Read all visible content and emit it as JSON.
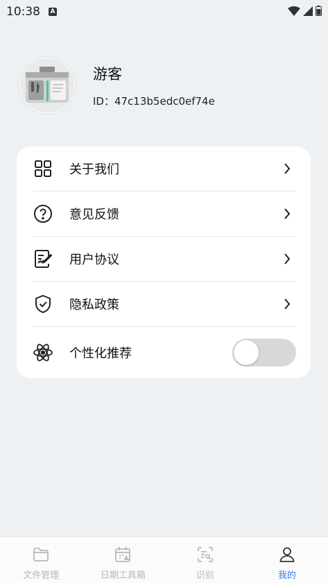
{
  "status_bar": {
    "time": "10:38",
    "notification_badge": "A"
  },
  "profile": {
    "name": "游客",
    "id_text": "ID：47c13b5edc0ef74e"
  },
  "menu": {
    "items": [
      {
        "label": "关于我们",
        "icon": "grid-icon"
      },
      {
        "label": "意见反馈",
        "icon": "question-icon"
      },
      {
        "label": "用户协议",
        "icon": "document-edit-icon"
      },
      {
        "label": "隐私政策",
        "icon": "shield-check-icon"
      }
    ],
    "toggle_item": {
      "label": "个性化推荐",
      "icon": "atom-icon",
      "enabled": false
    }
  },
  "bottom_nav": {
    "tabs": [
      {
        "label": "文件管理",
        "icon": "folder-icon",
        "active": false
      },
      {
        "label": "日期工具箱",
        "icon": "calendar-icon",
        "active": false
      },
      {
        "label": "识别",
        "icon": "scan-icon",
        "active": false
      },
      {
        "label": "我的",
        "icon": "user-icon",
        "active": true
      }
    ]
  },
  "colors": {
    "accent": "#3b7cf0",
    "background": "#eef1f4",
    "inactive_tab": "#b8b8b8"
  }
}
